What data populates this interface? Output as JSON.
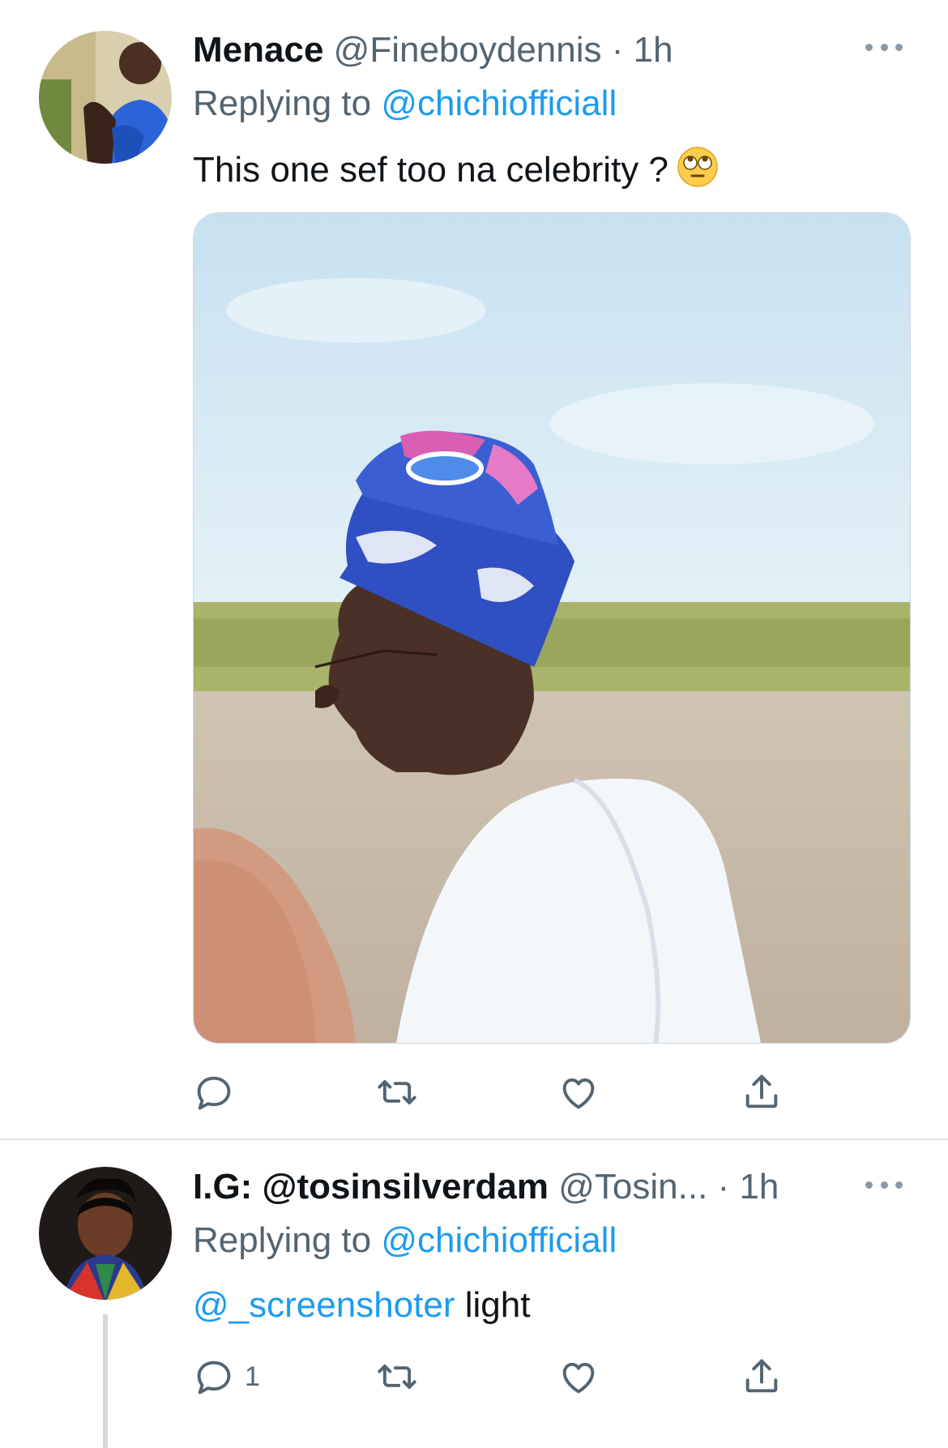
{
  "tweets": [
    {
      "name": "Menace",
      "handle": "@Fineboydennis",
      "separator": "·",
      "time": "1h",
      "replying_prefix": "Replying to",
      "replying_to": "@chichiofficiall",
      "text": "This one sef too na celebrity ?",
      "emoji": "face-with-rolling-eyes",
      "reply_count": "",
      "retweet_count": "",
      "like_count": ""
    },
    {
      "name": "I.G: @tosinsilverdam",
      "handle": "@Tosin...",
      "separator": "·",
      "time": "1h",
      "replying_prefix": "Replying to",
      "replying_to": "@chichiofficiall",
      "mention": "@_screenshoter",
      "text": "light",
      "reply_count": "1",
      "retweet_count": "",
      "like_count": ""
    }
  ],
  "colors": {
    "link": "#1d9bf0",
    "secondary_text": "#536471",
    "divider": "#dfe3e6"
  },
  "icons": [
    "more-icon",
    "reply-icon",
    "retweet-icon",
    "like-icon",
    "share-icon"
  ]
}
